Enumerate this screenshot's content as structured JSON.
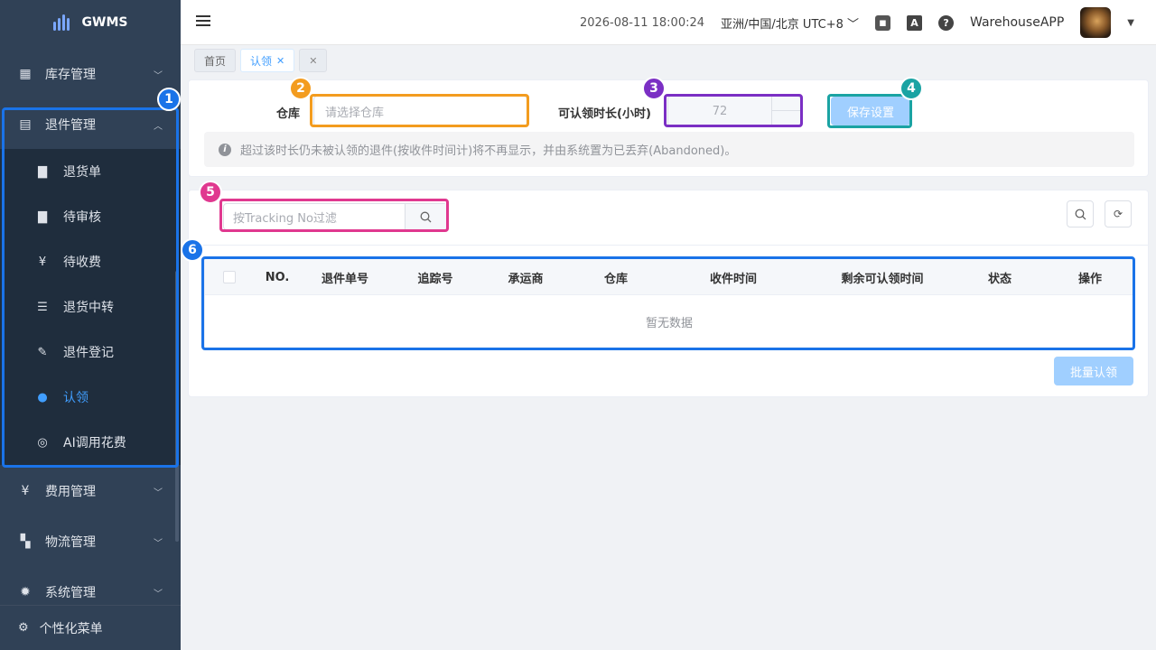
{
  "app": {
    "title": "GWMS"
  },
  "sidebar": {
    "menus": [
      {
        "label": "库存管理",
        "icon": "grid-table-icon",
        "state": "collapsed"
      },
      {
        "label": "退件管理",
        "icon": "return-box-icon",
        "state": "expanded"
      },
      {
        "label": "费用管理",
        "icon": "yen-icon",
        "state": "collapsed"
      },
      {
        "label": "物流管理",
        "icon": "apps-grid-icon",
        "state": "collapsed"
      },
      {
        "label": "系统管理",
        "icon": "gear-icon",
        "state": "collapsed"
      }
    ],
    "submenu": [
      {
        "label": "退货单",
        "icon": "document-icon"
      },
      {
        "label": "待审核",
        "icon": "document-icon"
      },
      {
        "label": "待收费",
        "icon": "yen-icon"
      },
      {
        "label": "退货中转",
        "icon": "list-tree-icon"
      },
      {
        "label": "退件登记",
        "icon": "edit-document-icon"
      },
      {
        "label": "认领",
        "icon": "user-icon",
        "active": true
      },
      {
        "label": "AI调用花费",
        "icon": "coin-icon"
      }
    ],
    "footer": {
      "label": "个性化菜单",
      "icon": "gear-outline-icon"
    }
  },
  "header": {
    "datetime": "2026-08-11 18:00:24",
    "timezone": "亚洲/中国/北京 UTC+8",
    "translate_glyph": "A",
    "help_glyph": "?",
    "user": "WarehouseAPP"
  },
  "tags": [
    {
      "label": "首页",
      "active": false
    },
    {
      "label": "认领",
      "active": true
    },
    {
      "label": "",
      "active": false
    }
  ],
  "settings": {
    "warehouse_label": "仓库",
    "warehouse_placeholder": "请选择仓库",
    "duration_label": "可认领时长(小时)",
    "duration_value": "72",
    "save_label": "保存设置",
    "notice": "超过该时长仍未被认领的退件(按收件时间计)将不再显示，并由系统置为已丢弃(Abandoned)。"
  },
  "filter": {
    "placeholder": "按Tracking No过滤"
  },
  "table": {
    "columns": [
      "NO.",
      "退件单号",
      "追踪号",
      "承运商",
      "仓库",
      "收件时间",
      "剩余可认领时间",
      "状态",
      "操作"
    ],
    "rows": [],
    "empty_text": "暂无数据"
  },
  "actions": {
    "batch_claim": "批量认领"
  },
  "annotations": {
    "labels": [
      "1",
      "2",
      "3",
      "4",
      "5",
      "6"
    ],
    "colors": {
      "blue": "#1a73e8",
      "orange": "#f39c1f",
      "purple": "#7b2fc4",
      "teal": "#1aa3a3",
      "pink": "#e0388f"
    }
  }
}
